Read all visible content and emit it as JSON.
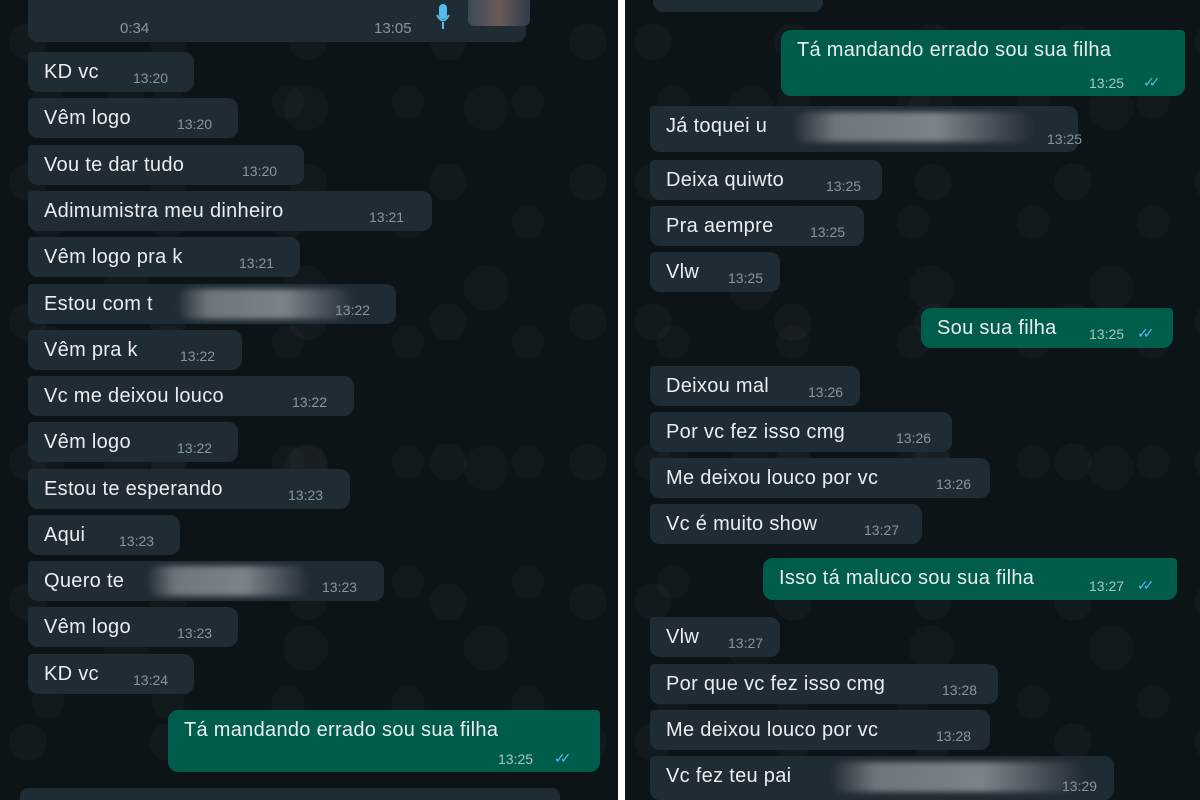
{
  "left": {
    "voice": {
      "duration": "0:34",
      "time": "13:05"
    },
    "messages": [
      {
        "text": "KD vc",
        "time": "13:20"
      },
      {
        "text": "Vêm logo",
        "time": "13:20"
      },
      {
        "text": "Vou te dar tudo",
        "time": "13:20"
      },
      {
        "text": "Adimumistra meu dinheiro",
        "time": "13:21"
      },
      {
        "text": "Vêm logo pra k",
        "time": "13:21"
      },
      {
        "text": "Estou com t",
        "time": "13:22"
      },
      {
        "text": "Vêm pra k",
        "time": "13:22"
      },
      {
        "text": "Vc me deixou louco",
        "time": "13:22"
      },
      {
        "text": "Vêm logo",
        "time": "13:22"
      },
      {
        "text": "Estou te esperando",
        "time": "13:23"
      },
      {
        "text": "Aqui",
        "time": "13:23"
      },
      {
        "text": "Quero te",
        "time": "13:23"
      },
      {
        "text": "Vêm logo",
        "time": "13:23"
      },
      {
        "text": "KD vc",
        "time": "13:24"
      }
    ],
    "outgoing": {
      "text": "Tá mandando errado sou sua filha",
      "time": "13:25"
    }
  },
  "right": {
    "outgoing_1": {
      "text": "Tá mandando errado sou sua filha",
      "time": "13:25"
    },
    "group_1": [
      {
        "text": "Já toquei u",
        "time": "13:25"
      },
      {
        "text": "Deixa quiwto",
        "time": "13:25"
      },
      {
        "text": "Pra aempre",
        "time": "13:25"
      },
      {
        "text": "Vlw",
        "time": "13:25"
      }
    ],
    "outgoing_2": {
      "text": "Sou sua filha",
      "time": "13:25"
    },
    "group_2": [
      {
        "text": "Deixou mal",
        "time": "13:26"
      },
      {
        "text": "Por vc fez isso cmg",
        "time": "13:26"
      },
      {
        "text": "Me deixou louco por vc",
        "time": "13:26"
      },
      {
        "text": "Vc é muito show",
        "time": "13:27"
      }
    ],
    "outgoing_3": {
      "text": "Isso tá maluco sou sua filha",
      "time": "13:27"
    },
    "group_3": [
      {
        "text": "Vlw",
        "time": "13:27"
      },
      {
        "text": "Por que vc fez isso cmg",
        "time": "13:28"
      },
      {
        "text": "Me deixou louco por vc",
        "time": "13:28"
      },
      {
        "text": "Vc fez teu pai",
        "time": "13:29"
      }
    ]
  },
  "colors": {
    "background": "#0d1418",
    "incoming_bubble": "#202c33",
    "outgoing_bubble": "#005c4b",
    "read_check": "#53bdeb",
    "timestamp": "#8696a0"
  },
  "icons": {
    "voice": "mic-icon",
    "read_receipt": "double-check-icon"
  }
}
